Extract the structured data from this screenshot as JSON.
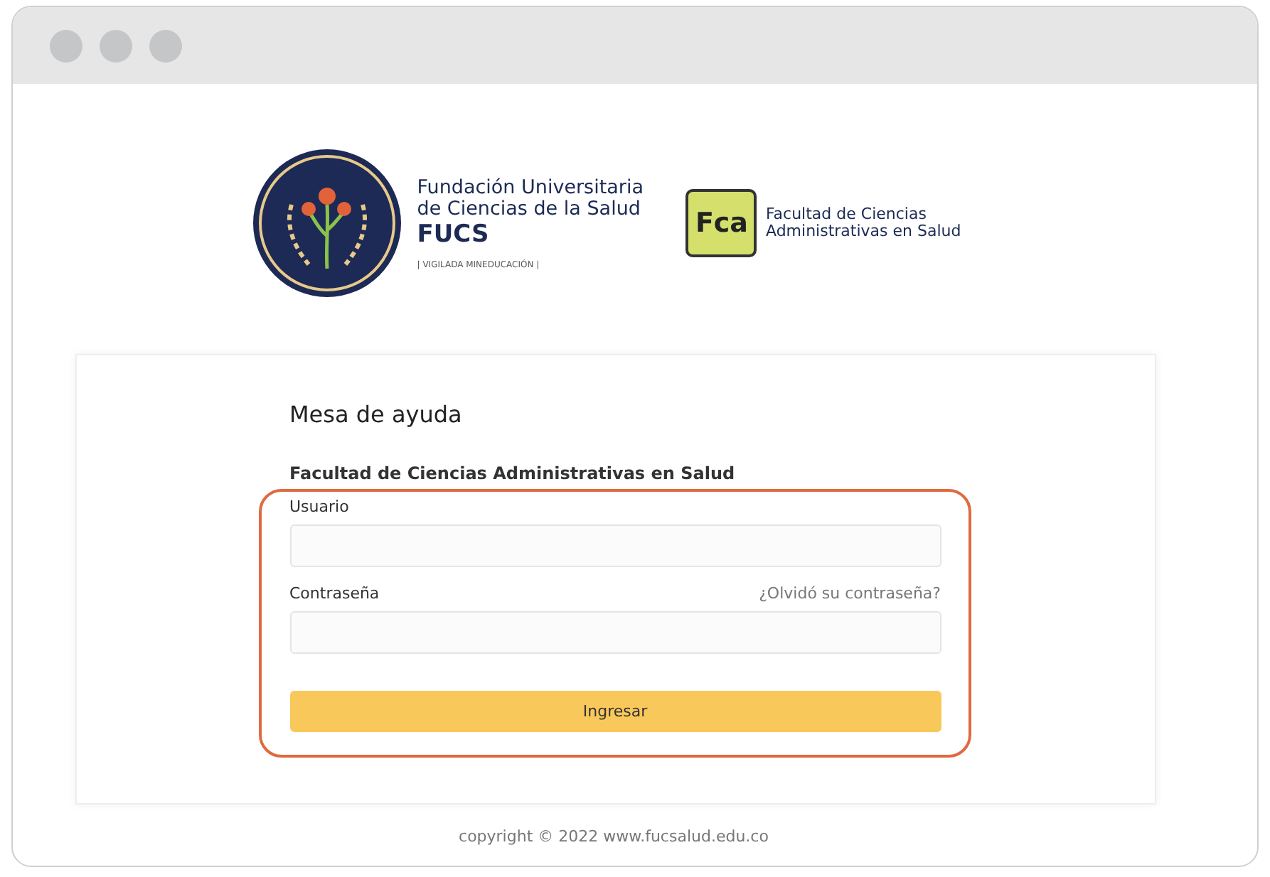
{
  "fucs_logo": {
    "lines": [
      "Fundación Universitaria",
      "de Ciencias de la Salud"
    ],
    "acronym": "FUCS",
    "tagline": "| VIGILADA MINEDUCACIÓN |"
  },
  "fca_logo": {
    "mark": "Fca",
    "lines": [
      "Facultad de Ciencias",
      "Administrativas en Salud"
    ]
  },
  "form": {
    "title": "Mesa de ayuda",
    "subtitle": "Facultad de Ciencias Administrativas en Salud",
    "fields": [
      {
        "label": "Usuario"
      },
      {
        "label": "Contraseña",
        "link": "¿Olvidó su contraseña?"
      }
    ],
    "button": "Ingresar"
  },
  "footer": "copyright © 2022 www.fucsalud.edu.co"
}
